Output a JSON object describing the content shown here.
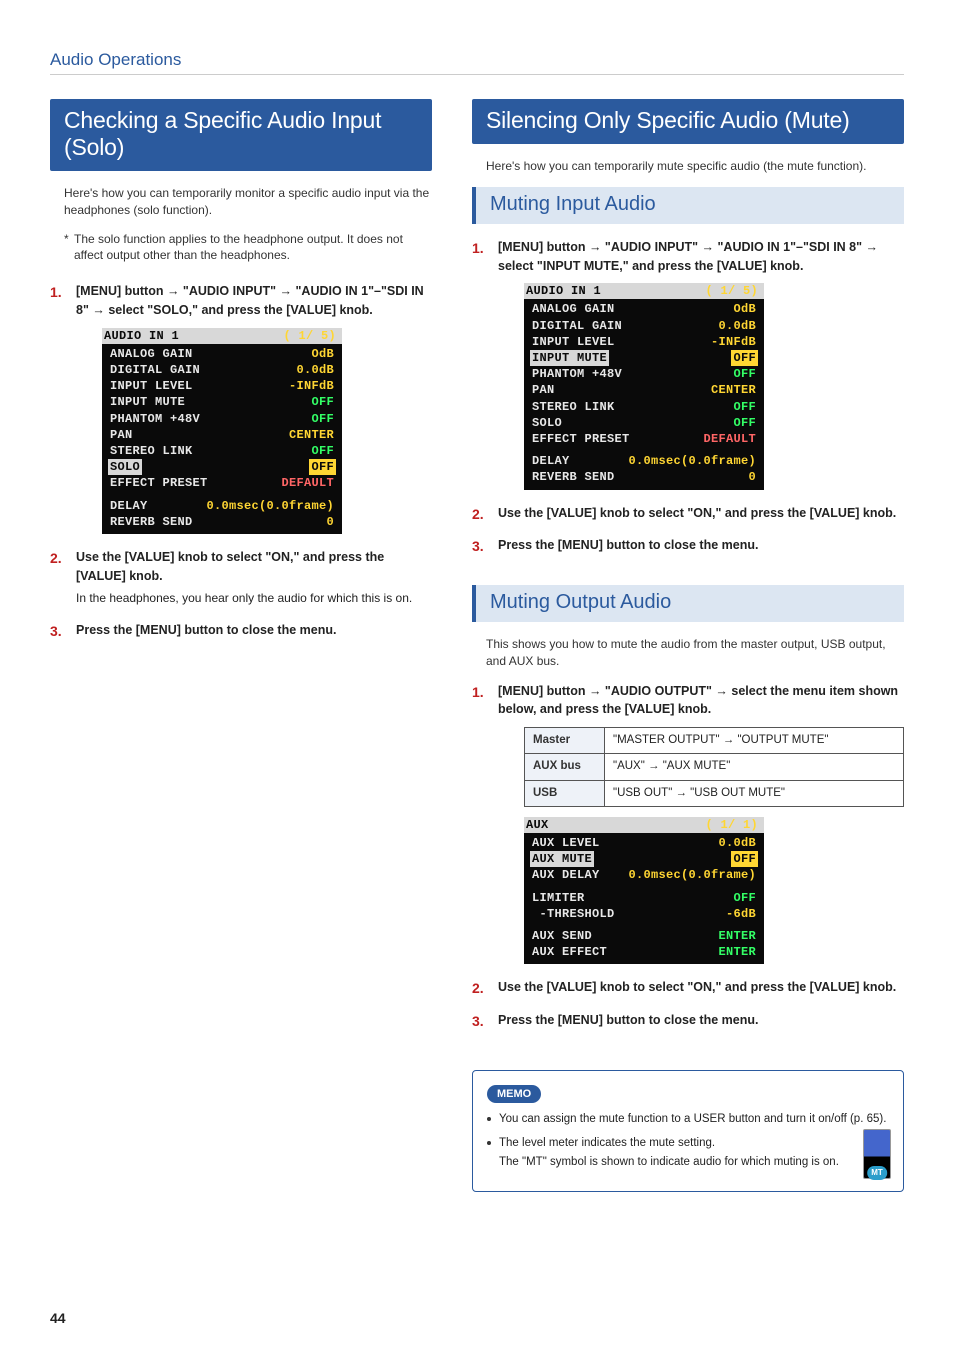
{
  "section": "Audio Operations",
  "page_number": "44",
  "left": {
    "title": "Checking a Specific Audio Input (Solo)",
    "intro": "Here's how you can temporarily monitor a specific audio input via the headphones (solo function).",
    "note": "The solo function applies to the headphone output. It does not affect output other than the headphones.",
    "step1_a": "[MENU] button ",
    "step1_b": " \"AUDIO INPUT\" ",
    "step1_c": " \"AUDIO IN 1\"–\"SDI IN 8\" ",
    "step1_d": " select \"SOLO,\" and press the [VALUE] knob.",
    "lcd": {
      "title": "AUDIO IN 1",
      "page": "( 1/ 5)",
      "rows": [
        {
          "k": "ANALOG GAIN",
          "v": "OdB",
          "c": "ylw"
        },
        {
          "k": "DIGITAL GAIN",
          "v": "0.0dB",
          "c": "ylw"
        },
        {
          "k": "INPUT LEVEL",
          "v": "-INFdB",
          "c": "ylw"
        },
        {
          "k": "INPUT MUTE",
          "v": "OFF",
          "c": "grn"
        },
        {
          "k": "PHANTOM +48V",
          "v": "OFF",
          "c": "grn"
        },
        {
          "k": "PAN",
          "v": "CENTER",
          "c": "ylw"
        },
        {
          "k": "STEREO LINK",
          "v": "OFF",
          "c": "grn"
        }
      ],
      "hl": {
        "k": "SOLO",
        "v": "OFF"
      },
      "rows2": [
        {
          "k": "EFFECT PRESET",
          "v": "DEFAULT",
          "c": "def"
        }
      ],
      "rows3": [
        {
          "k": "DELAY",
          "v": "0.0msec(0.0frame)",
          "c": "ylw"
        },
        {
          "k": "REVERB SEND",
          "v": "0",
          "c": "ylw"
        }
      ]
    },
    "step2": "Use the [VALUE] knob to select \"ON,\" and press the [VALUE] knob.",
    "step2_sub": "In the headphones, you hear only the audio for which this is on.",
    "step3": "Press the [MENU] button to close the menu."
  },
  "right": {
    "title": "Silencing Only Specific Audio (Mute)",
    "intro": "Here's how you can temporarily mute specific audio (the mute function).",
    "sec1": {
      "title": "Muting Input Audio",
      "step1_a": "[MENU] button ",
      "step1_b": " \"AUDIO INPUT\" ",
      "step1_c": " \"AUDIO IN 1\"–\"SDI IN 8\" ",
      "step1_d": " select \"INPUT MUTE,\" and press the [VALUE] knob.",
      "lcd": {
        "title": "AUDIO IN 1",
        "page": "( 1/ 5)",
        "rows": [
          {
            "k": "ANALOG GAIN",
            "v": "OdB",
            "c": "ylw"
          },
          {
            "k": "DIGITAL GAIN",
            "v": "0.0dB",
            "c": "ylw"
          },
          {
            "k": "INPUT LEVEL",
            "v": "-INFdB",
            "c": "ylw"
          }
        ],
        "hl": {
          "k": "INPUT MUTE",
          "v": "OFF"
        },
        "rows2": [
          {
            "k": "PHANTOM +48V",
            "v": "OFF",
            "c": "grn"
          },
          {
            "k": "PAN",
            "v": "CENTER",
            "c": "ylw"
          },
          {
            "k": "STEREO LINK",
            "v": "OFF",
            "c": "grn"
          },
          {
            "k": "SOLO",
            "v": "OFF",
            "c": "grn"
          },
          {
            "k": "EFFECT PRESET",
            "v": "DEFAULT",
            "c": "def"
          }
        ],
        "rows3": [
          {
            "k": "DELAY",
            "v": "0.0msec(0.0frame)",
            "c": "ylw"
          },
          {
            "k": "REVERB SEND",
            "v": "0",
            "c": "ylw"
          }
        ]
      },
      "step2": "Use the [VALUE] knob to select \"ON,\" and press the [VALUE] knob.",
      "step3": "Press the [MENU] button to close the menu."
    },
    "sec2": {
      "title": "Muting Output Audio",
      "intro": "This shows you how to mute the audio from the master output, USB output, and AUX bus.",
      "step1_a": "[MENU] button ",
      "step1_b": " \"AUDIO OUTPUT\" ",
      "step1_c": " select the menu item shown below, and press the [VALUE] knob.",
      "table": [
        {
          "k": "Master",
          "v": "\"MASTER OUTPUT\" → \"OUTPUT MUTE\""
        },
        {
          "k": "AUX bus",
          "v": "\"AUX\" → \"AUX MUTE\""
        },
        {
          "k": "USB",
          "v": "\"USB OUT\" → \"USB OUT MUTE\""
        }
      ],
      "lcd": {
        "title": "AUX",
        "page": "( 1/ 1)",
        "rows": [
          {
            "k": "AUX LEVEL",
            "v": "0.0dB",
            "c": "ylw"
          }
        ],
        "hl": {
          "k": "AUX MUTE",
          "v": "OFF"
        },
        "rows2": [
          {
            "k": "AUX DELAY",
            "v": "0.0msec(0.0frame)",
            "c": "ylw"
          }
        ],
        "rows3": [
          {
            "k": "LIMITER",
            "v": "OFF",
            "c": "grn"
          },
          {
            "k": " -THRESHOLD",
            "v": "-6dB",
            "c": "ylw"
          }
        ],
        "rows4": [
          {
            "k": "AUX SEND",
            "v": "ENTER",
            "c": "grn"
          },
          {
            "k": "AUX EFFECT",
            "v": "ENTER",
            "c": "grn"
          }
        ]
      },
      "step2": "Use the [VALUE] knob to select \"ON,\" and press the [VALUE] knob.",
      "step3": "Press the [MENU] button to close the menu."
    },
    "memo": {
      "tag": "MEMO",
      "item1": "You can assign the mute function to a USER button and turn it on/off (p. 65).",
      "item2": "The level meter indicates the mute setting.",
      "item2_sub": "The \"MT\" symbol is shown to indicate audio for which muting is on."
    }
  }
}
